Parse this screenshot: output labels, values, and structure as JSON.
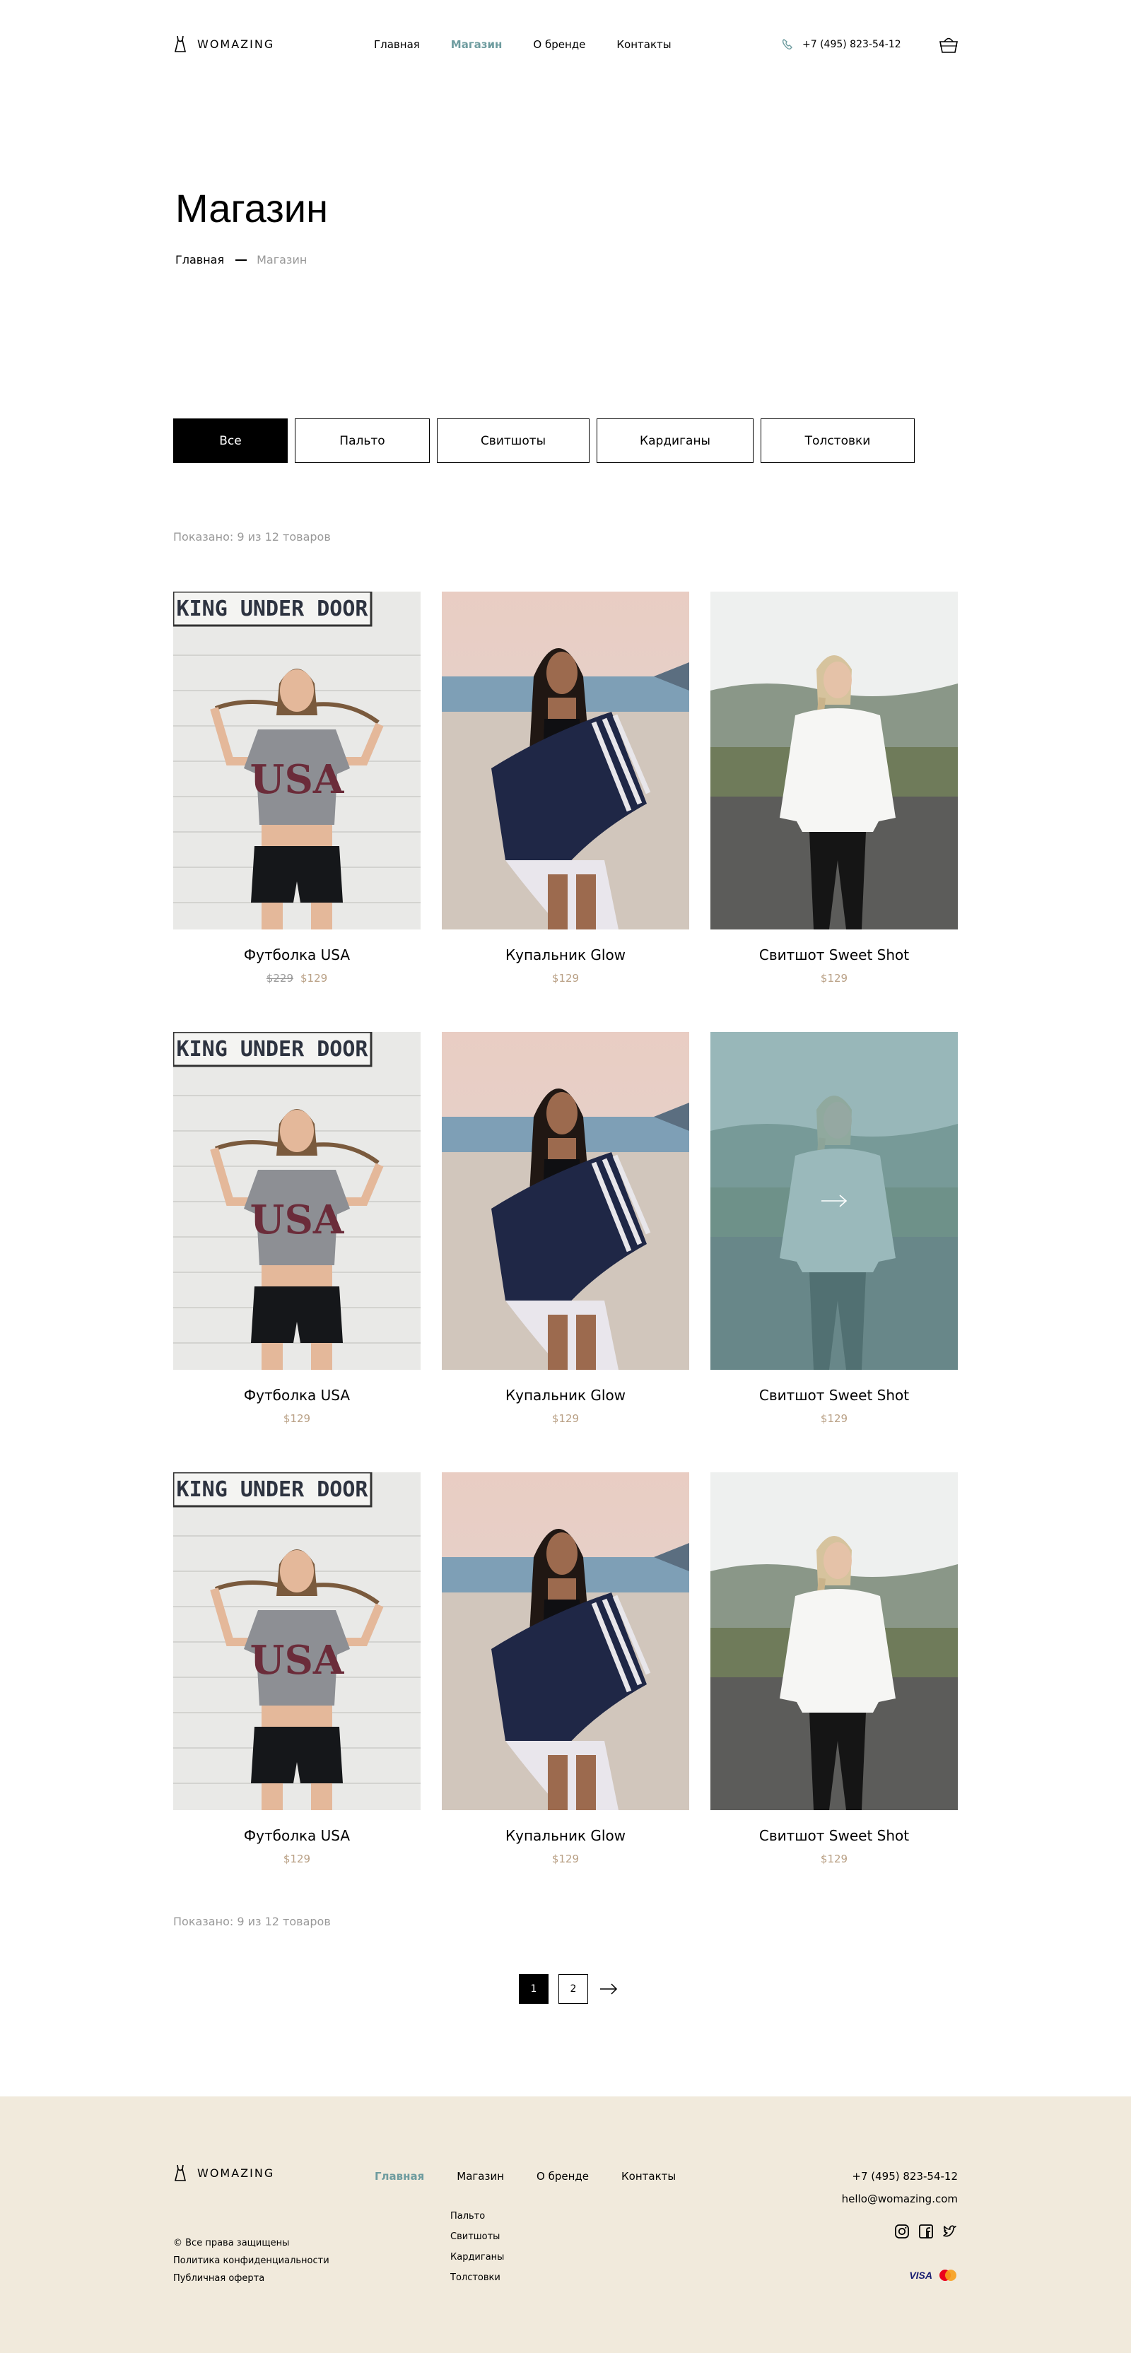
{
  "header": {
    "logo": "WOMAZING",
    "nav": [
      {
        "label": "Главная",
        "active": false
      },
      {
        "label": "Магазин",
        "active": true
      },
      {
        "label": "О бренде",
        "active": false
      },
      {
        "label": "Контакты",
        "active": false
      }
    ],
    "phone": "+7 (495) 823-54-12"
  },
  "page": {
    "title": "Магазин",
    "breadcrumb": [
      "Главная",
      "Магазин"
    ]
  },
  "filters": [
    {
      "label": "Все",
      "active": true
    },
    {
      "label": "Пальто",
      "active": false
    },
    {
      "label": "Свитшоты",
      "active": false
    },
    {
      "label": "Кардиганы",
      "active": false
    },
    {
      "label": "Толстовки",
      "active": false
    }
  ],
  "shown_text": "Показано: 9 из 12 товаров",
  "products": [
    {
      "name": "Футболка USA",
      "old_price": "$229",
      "price": "$129",
      "photo": "usa"
    },
    {
      "name": "Купальник Glow",
      "old_price": "",
      "price": "$129",
      "photo": "glow"
    },
    {
      "name": "Свитшот Sweet Shot",
      "old_price": "",
      "price": "$129",
      "photo": "sweet"
    },
    {
      "name": "Футболка USA",
      "old_price": "",
      "price": "$129",
      "photo": "usa"
    },
    {
      "name": "Купальник Glow",
      "old_price": "",
      "price": "$129",
      "photo": "glow"
    },
    {
      "name": "Свитшот Sweet Shot",
      "old_price": "",
      "price": "$129",
      "photo": "sweet",
      "hover": true
    },
    {
      "name": "Футболка USA",
      "old_price": "",
      "price": "$129",
      "photo": "usa"
    },
    {
      "name": "Купальник Glow",
      "old_price": "",
      "price": "$129",
      "photo": "glow"
    },
    {
      "name": "Свитшот Sweet Shot",
      "old_price": "",
      "price": "$129",
      "photo": "sweet"
    }
  ],
  "usa_sign": "KING UNDER DOOR",
  "usa_print": "USA",
  "pagination": {
    "pages": [
      "1",
      "2"
    ],
    "current": "1"
  },
  "footer": {
    "logo": "WOMAZING",
    "nav": [
      {
        "label": "Главная",
        "active": true
      },
      {
        "label": "Магазин",
        "active": false
      },
      {
        "label": "О бренде",
        "active": false
      },
      {
        "label": "Контакты",
        "active": false
      }
    ],
    "sub_nav": [
      "Пальто",
      "Свитшоты",
      "Кардиганы",
      "Толстовки"
    ],
    "legal": [
      "© Все права защищены",
      "Политика конфиденциальности",
      "Публичная оферта"
    ],
    "phone": "+7 (495) 823-54-12",
    "email": "hello@womazing.com",
    "payment": "VISA",
    "colors": {
      "accent": "#6E9C9F",
      "price": "#B9A085",
      "footer_bg": "#F1EADC"
    }
  }
}
